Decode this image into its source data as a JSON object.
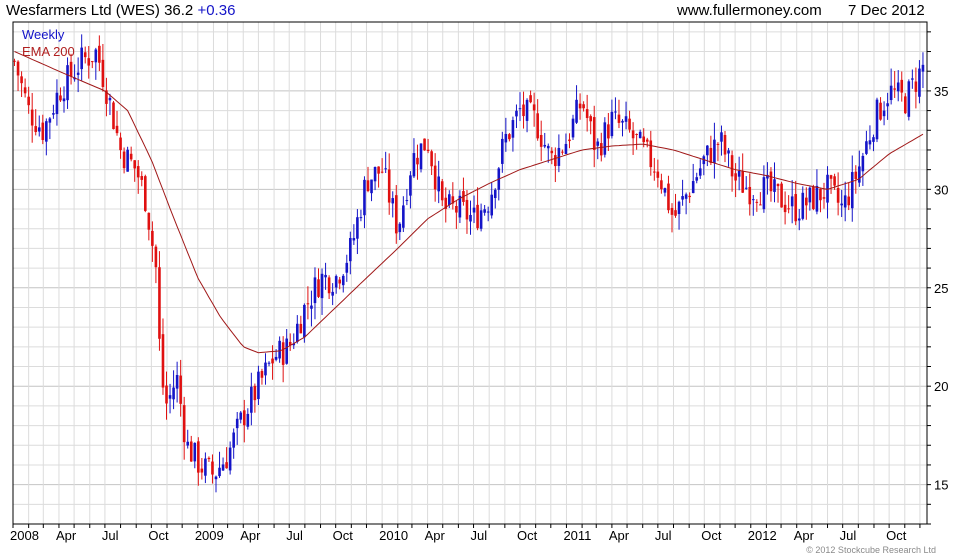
{
  "header": {
    "title": "Wesfarmers Ltd (WES) 36.2",
    "change": "+0.36",
    "site": "www.fullermoney.com",
    "date": "7 Dec 2012"
  },
  "legend": {
    "weekly": "Weekly",
    "ema": "EMA 200"
  },
  "credit": "© 2012 Stockcube Research Ltd",
  "colors": {
    "up": "#1414c8",
    "down": "#e01010",
    "ema": "#a01818",
    "grid": "#dcdcdc",
    "border": "#000000"
  },
  "chart_data": {
    "type": "candlestick",
    "title": "Wesfarmers Ltd (WES) 36.2 +0.36",
    "frequency": "Weekly",
    "x_range": [
      "2008-01-04",
      "2012-12-07"
    ],
    "ylim": [
      13.0,
      38.5
    ],
    "y_ticks": [
      15,
      20,
      25,
      30,
      35
    ],
    "x_ticks": [
      {
        "label": "2008",
        "date": "2008-01-01"
      },
      {
        "label": "Apr",
        "date": "2008-04-01"
      },
      {
        "label": "Jul",
        "date": "2008-07-01"
      },
      {
        "label": "Oct",
        "date": "2008-10-01"
      },
      {
        "label": "2009",
        "date": "2009-01-01"
      },
      {
        "label": "Apr",
        "date": "2009-04-01"
      },
      {
        "label": "Jul",
        "date": "2009-07-01"
      },
      {
        "label": "Oct",
        "date": "2009-10-01"
      },
      {
        "label": "2010",
        "date": "2010-01-01"
      },
      {
        "label": "Apr",
        "date": "2010-04-01"
      },
      {
        "label": "Jul",
        "date": "2010-07-01"
      },
      {
        "label": "Oct",
        "date": "2010-10-01"
      },
      {
        "label": "2011",
        "date": "2011-01-01"
      },
      {
        "label": "Apr",
        "date": "2011-04-01"
      },
      {
        "label": "Jul",
        "date": "2011-07-01"
      },
      {
        "label": "Oct",
        "date": "2011-10-01"
      },
      {
        "label": "2012",
        "date": "2012-01-01"
      },
      {
        "label": "Apr",
        "date": "2012-04-01"
      },
      {
        "label": "Jul",
        "date": "2012-07-01"
      },
      {
        "label": "Oct",
        "date": "2012-10-01"
      }
    ],
    "grid": true,
    "price_path": [
      [
        "2008-01-04",
        36.5
      ],
      [
        "2008-02-01",
        34.0
      ],
      [
        "2008-03-01",
        33.0
      ],
      [
        "2008-04-01",
        35.0
      ],
      [
        "2008-05-15",
        36.5
      ],
      [
        "2008-06-15",
        37.0
      ],
      [
        "2008-07-10",
        34.5
      ],
      [
        "2008-08-01",
        32.0
      ],
      [
        "2008-09-01",
        31.0
      ],
      [
        "2008-09-20",
        29.5
      ],
      [
        "2008-10-10",
        26.0
      ],
      [
        "2008-10-20",
        20.5
      ],
      [
        "2008-11-01",
        19.0
      ],
      [
        "2008-11-20",
        20.5
      ],
      [
        "2008-12-10",
        17.0
      ],
      [
        "2009-01-05",
        16.0
      ],
      [
        "2009-02-01",
        15.5
      ],
      [
        "2009-03-01",
        16.5
      ],
      [
        "2009-04-01",
        18.5
      ],
      [
        "2009-05-01",
        20.0
      ],
      [
        "2009-06-01",
        21.5
      ],
      [
        "2009-07-01",
        22.0
      ],
      [
        "2009-08-01",
        24.0
      ],
      [
        "2009-09-01",
        25.5
      ],
      [
        "2009-10-01",
        25.5
      ],
      [
        "2009-11-01",
        27.0
      ],
      [
        "2009-12-01",
        30.5
      ],
      [
        "2010-01-01",
        31.0
      ],
      [
        "2010-02-01",
        28.0
      ],
      [
        "2010-03-01",
        31.5
      ],
      [
        "2010-04-01",
        32.5
      ],
      [
        "2010-05-01",
        29.0
      ],
      [
        "2010-06-01",
        29.0
      ],
      [
        "2010-07-01",
        28.5
      ],
      [
        "2010-08-01",
        29.5
      ],
      [
        "2010-09-01",
        32.5
      ],
      [
        "2010-10-01",
        34.0
      ],
      [
        "2010-11-01",
        33.5
      ],
      [
        "2010-12-01",
        31.5
      ],
      [
        "2011-01-01",
        32.5
      ],
      [
        "2011-02-01",
        34.5
      ],
      [
        "2011-03-01",
        32.0
      ],
      [
        "2011-04-01",
        33.5
      ],
      [
        "2011-05-01",
        33.0
      ],
      [
        "2011-06-01",
        32.0
      ],
      [
        "2011-07-01",
        31.0
      ],
      [
        "2011-08-01",
        28.5
      ],
      [
        "2011-09-01",
        30.0
      ],
      [
        "2011-10-01",
        31.5
      ],
      [
        "2011-11-01",
        32.5
      ],
      [
        "2011-12-01",
        30.5
      ],
      [
        "2012-01-01",
        30.0
      ],
      [
        "2012-02-01",
        30.0
      ],
      [
        "2012-03-01",
        29.5
      ],
      [
        "2012-04-01",
        29.0
      ],
      [
        "2012-05-01",
        29.5
      ],
      [
        "2012-06-01",
        30.0
      ],
      [
        "2012-07-01",
        29.0
      ],
      [
        "2012-08-01",
        31.0
      ],
      [
        "2012-09-01",
        33.5
      ],
      [
        "2012-10-01",
        35.0
      ],
      [
        "2012-11-01",
        34.5
      ],
      [
        "2012-12-07",
        36.2
      ]
    ],
    "ema_200": [
      [
        "2008-01-04",
        37.0
      ],
      [
        "2008-04-01",
        36.0
      ],
      [
        "2008-07-01",
        35.0
      ],
      [
        "2008-08-15",
        34.0
      ],
      [
        "2008-10-01",
        31.5
      ],
      [
        "2008-11-15",
        28.5
      ],
      [
        "2009-01-01",
        25.5
      ],
      [
        "2009-02-15",
        23.5
      ],
      [
        "2009-04-01",
        22.0
      ],
      [
        "2009-05-01",
        21.7
      ],
      [
        "2009-06-15",
        21.8
      ],
      [
        "2009-08-01",
        22.5
      ],
      [
        "2009-10-01",
        24.0
      ],
      [
        "2009-12-01",
        25.5
      ],
      [
        "2010-02-01",
        27.0
      ],
      [
        "2010-04-01",
        28.5
      ],
      [
        "2010-06-01",
        29.5
      ],
      [
        "2010-08-01",
        30.3
      ],
      [
        "2010-10-01",
        31.0
      ],
      [
        "2010-12-01",
        31.5
      ],
      [
        "2011-02-01",
        32.0
      ],
      [
        "2011-04-01",
        32.2
      ],
      [
        "2011-06-01",
        32.3
      ],
      [
        "2011-08-01",
        32.0
      ],
      [
        "2011-10-01",
        31.5
      ],
      [
        "2011-12-01",
        31.0
      ],
      [
        "2012-02-01",
        30.7
      ],
      [
        "2012-04-01",
        30.3
      ],
      [
        "2012-06-01",
        30.0
      ],
      [
        "2012-08-01",
        30.5
      ],
      [
        "2012-10-01",
        31.8
      ],
      [
        "2012-12-07",
        32.8
      ]
    ],
    "series": [
      {
        "name": "Weekly"
      },
      {
        "name": "EMA 200"
      }
    ]
  }
}
